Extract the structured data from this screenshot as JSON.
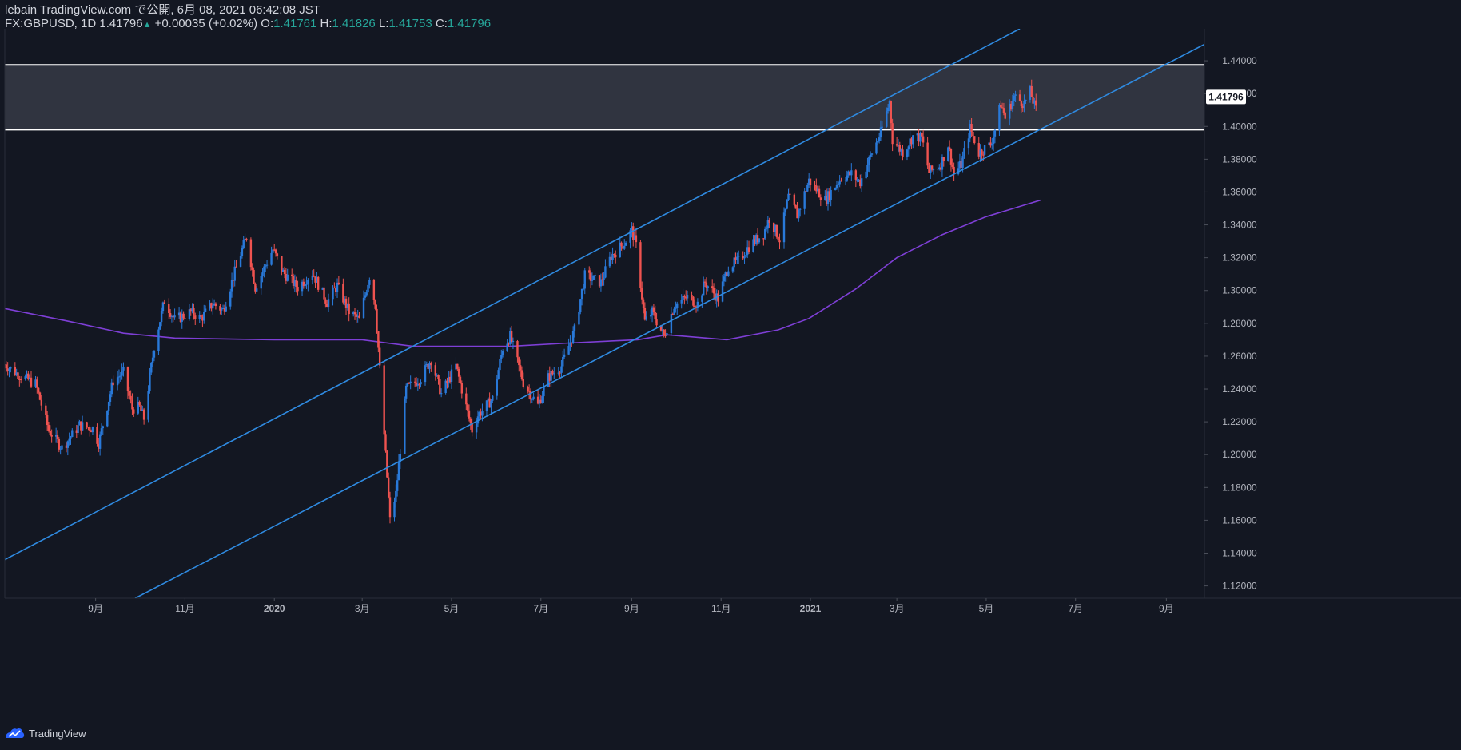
{
  "header": {
    "line1": "lebain TradingView.com で公開, 6月 08, 2021 06:42:08 JST",
    "symbol": "FX:GBPUSD, 1D",
    "last": "1.41796",
    "arrow": "▲",
    "change": "+0.00035 (+0.02%)",
    "o_label": "O:",
    "o": "1.41761",
    "h_label": "H:",
    "h": "1.41826",
    "l_label": "L:",
    "l": "1.41753",
    "c_label": "C:",
    "c": "1.41796"
  },
  "footer": {
    "brand": "TradingView",
    "icon": "tradingview-logo-icon"
  },
  "colors": {
    "background": "#131722",
    "up": "#2979d9",
    "down": "#ef5350",
    "ma": "#7e3fd6",
    "channel": "#2f8ae0",
    "zone_fill": "#363a45",
    "zone_border": "#ffffff",
    "axis_text": "#b2b5be",
    "last_price_label_bg": "#ffffff",
    "last_price_label_text": "#131722"
  },
  "chart_data": {
    "type": "candlestick",
    "symbol": "FX:GBPUSD",
    "interval": "1D",
    "x_axis": {
      "ticks": [
        {
          "label": "9月",
          "date": "2019-09-01"
        },
        {
          "label": "11月",
          "date": "2019-11-01"
        },
        {
          "label": "2020",
          "date": "2020-01-01"
        },
        {
          "label": "3月",
          "date": "2020-03-01"
        },
        {
          "label": "5月",
          "date": "2020-05-01"
        },
        {
          "label": "7月",
          "date": "2020-07-01"
        },
        {
          "label": "9月",
          "date": "2020-09-01"
        },
        {
          "label": "11月",
          "date": "2020-11-01"
        },
        {
          "label": "2021",
          "date": "2021-01-01"
        },
        {
          "label": "3月",
          "date": "2021-03-01"
        },
        {
          "label": "5月",
          "date": "2021-05-01"
        },
        {
          "label": "7月",
          "date": "2021-07-01"
        },
        {
          "label": "9月",
          "date": "2021-09-01"
        }
      ],
      "range": [
        "2019-07-01",
        "2021-09-27"
      ]
    },
    "y_axis": {
      "ticks": [
        "1.44000",
        "1.42000",
        "1.40000",
        "1.38000",
        "1.36000",
        "1.34000",
        "1.32000",
        "1.30000",
        "1.28000",
        "1.26000",
        "1.24000",
        "1.22000",
        "1.20000",
        "1.18000",
        "1.16000",
        "1.14000",
        "1.12000"
      ],
      "range": [
        1.1125,
        1.4595
      ]
    },
    "last_price": "1.41796",
    "price_path": [
      [
        "2019-07-01",
        1.255
      ],
      [
        "2019-07-10",
        1.249
      ],
      [
        "2019-07-22",
        1.243
      ],
      [
        "2019-07-31",
        1.215
      ],
      [
        "2019-08-09",
        1.204
      ],
      [
        "2019-08-21",
        1.218
      ],
      [
        "2019-08-30",
        1.216
      ],
      [
        "2019-09-03",
        1.207
      ],
      [
        "2019-09-13",
        1.245
      ],
      [
        "2019-09-20",
        1.25
      ],
      [
        "2019-09-26",
        1.228
      ],
      [
        "2019-10-01",
        1.229
      ],
      [
        "2019-10-04",
        1.222
      ],
      [
        "2019-10-11",
        1.266
      ],
      [
        "2019-10-18",
        1.294
      ],
      [
        "2019-10-25",
        1.282
      ],
      [
        "2019-11-05",
        1.287
      ],
      [
        "2019-11-12",
        1.283
      ],
      [
        "2019-11-20",
        1.292
      ],
      [
        "2019-11-27",
        1.288
      ],
      [
        "2019-12-06",
        1.314
      ],
      [
        "2019-12-13",
        1.333
      ],
      [
        "2019-12-19",
        1.302
      ],
      [
        "2019-12-31",
        1.325
      ],
      [
        "2020-01-07",
        1.311
      ],
      [
        "2020-01-17",
        1.302
      ],
      [
        "2020-01-27",
        1.311
      ],
      [
        "2020-02-06",
        1.293
      ],
      [
        "2020-02-13",
        1.303
      ],
      [
        "2020-02-21",
        1.287
      ],
      [
        "2020-02-28",
        1.282
      ],
      [
        "2020-03-06",
        1.309
      ],
      [
        "2020-03-10",
        1.291
      ],
      [
        "2020-03-13",
        1.252
      ],
      [
        "2020-03-20",
        1.16
      ],
      [
        "2020-03-24",
        1.176
      ],
      [
        "2020-03-31",
        1.24
      ],
      [
        "2020-04-10",
        1.247
      ],
      [
        "2020-04-17",
        1.258
      ],
      [
        "2020-04-24",
        1.237
      ],
      [
        "2020-05-04",
        1.254
      ],
      [
        "2020-05-15",
        1.215
      ],
      [
        "2020-05-19",
        1.224
      ],
      [
        "2020-05-29",
        1.234
      ],
      [
        "2020-06-05",
        1.265
      ],
      [
        "2020-06-10",
        1.272
      ],
      [
        "2020-06-19",
        1.244
      ],
      [
        "2020-06-29",
        1.23
      ],
      [
        "2020-07-06",
        1.247
      ],
      [
        "2020-07-15",
        1.254
      ],
      [
        "2020-07-24",
        1.276
      ],
      [
        "2020-07-31",
        1.309
      ],
      [
        "2020-08-11",
        1.305
      ],
      [
        "2020-08-18",
        1.321
      ],
      [
        "2020-08-27",
        1.329
      ],
      [
        "2020-09-01",
        1.337
      ],
      [
        "2020-09-04",
        1.327
      ],
      [
        "2020-09-10",
        1.281
      ],
      [
        "2020-09-15",
        1.287
      ],
      [
        "2020-09-23",
        1.272
      ],
      [
        "2020-09-30",
        1.291
      ],
      [
        "2020-10-09",
        1.296
      ],
      [
        "2020-10-16",
        1.292
      ],
      [
        "2020-10-21",
        1.305
      ],
      [
        "2020-10-30",
        1.295
      ],
      [
        "2020-11-06",
        1.315
      ],
      [
        "2020-11-13",
        1.318
      ],
      [
        "2020-11-20",
        1.327
      ],
      [
        "2020-11-30",
        1.335
      ],
      [
        "2020-12-04",
        1.344
      ],
      [
        "2020-12-11",
        1.331
      ],
      [
        "2020-12-17",
        1.357
      ],
      [
        "2020-12-23",
        1.346
      ],
      [
        "2020-12-31",
        1.367
      ],
      [
        "2021-01-11",
        1.355
      ],
      [
        "2021-01-22",
        1.369
      ],
      [
        "2021-01-29",
        1.371
      ],
      [
        "2021-02-04",
        1.366
      ],
      [
        "2021-02-12",
        1.384
      ],
      [
        "2021-02-18",
        1.396
      ],
      [
        "2021-02-24",
        1.415
      ],
      [
        "2021-02-26",
        1.392
      ],
      [
        "2021-03-05",
        1.384
      ],
      [
        "2021-03-12",
        1.394
      ],
      [
        "2021-03-18",
        1.393
      ],
      [
        "2021-03-23",
        1.372
      ],
      [
        "2021-03-31",
        1.377
      ],
      [
        "2021-04-05",
        1.389
      ],
      [
        "2021-04-09",
        1.371
      ],
      [
        "2021-04-14",
        1.377
      ],
      [
        "2021-04-20",
        1.399
      ],
      [
        "2021-04-26",
        1.384
      ],
      [
        "2021-05-04",
        1.389
      ],
      [
        "2021-05-07",
        1.398
      ],
      [
        "2021-05-11",
        1.414
      ],
      [
        "2021-05-14",
        1.405
      ],
      [
        "2021-05-20",
        1.418
      ],
      [
        "2021-05-27",
        1.414
      ],
      [
        "2021-05-31",
        1.421
      ],
      [
        "2021-06-04",
        1.41
      ],
      [
        "2021-06-07",
        1.418
      ]
    ],
    "moving_average": [
      [
        "2019-07-01",
        1.289
      ],
      [
        "2019-08-15",
        1.281
      ],
      [
        "2019-09-20",
        1.274
      ],
      [
        "2019-10-25",
        1.271
      ],
      [
        "2020-01-01",
        1.27
      ],
      [
        "2020-03-01",
        1.27
      ],
      [
        "2020-04-05",
        1.266
      ],
      [
        "2020-06-10",
        1.266
      ],
      [
        "2020-07-20",
        1.268
      ],
      [
        "2020-09-05",
        1.27
      ],
      [
        "2020-09-25",
        1.273
      ],
      [
        "2020-11-05",
        1.27
      ],
      [
        "2020-12-10",
        1.276
      ],
      [
        "2020-12-31",
        1.283
      ],
      [
        "2021-02-01",
        1.301
      ],
      [
        "2021-03-01",
        1.32
      ],
      [
        "2021-04-01",
        1.334
      ],
      [
        "2021-05-01",
        1.345
      ],
      [
        "2021-06-07",
        1.355
      ]
    ],
    "channel_lines": [
      {
        "name": "upper",
        "points": [
          [
            "2019-07-01",
            1.136
          ],
          [
            "2021-05-24",
            1.4595
          ]
        ]
      },
      {
        "name": "lower",
        "points": [
          [
            "2019-09-28",
            1.1125
          ],
          [
            "2021-09-27",
            1.45
          ]
        ]
      }
    ],
    "resistance_zone": {
      "from": 1.398,
      "to": 1.4375
    },
    "legend": "none",
    "grid": false
  }
}
